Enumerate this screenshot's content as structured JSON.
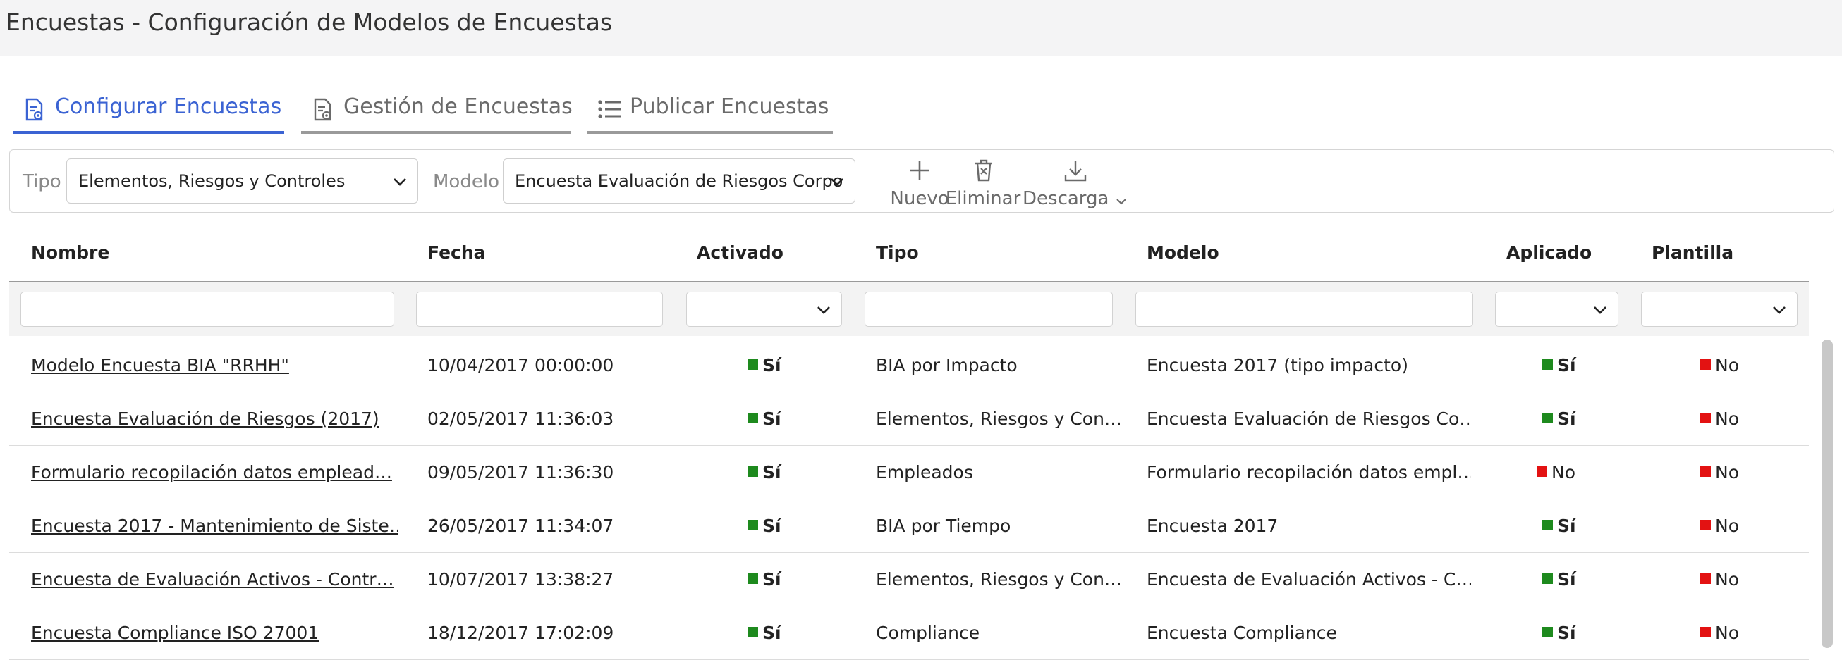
{
  "page": {
    "title": "Encuestas  - Configuración de Modelos de Encuestas"
  },
  "tabs": [
    {
      "label": "Configurar Encuestas",
      "icon": "document-gear-icon",
      "active": true
    },
    {
      "label": "Gestión de Encuestas",
      "icon": "document-gear-icon",
      "active": false
    },
    {
      "label": "Publicar Encuestas",
      "icon": "list-icon",
      "active": false
    }
  ],
  "filters": {
    "tipo_label": "Tipo",
    "tipo_value": "Elementos, Riesgos y Controles",
    "modelo_label": "Modelo",
    "modelo_value": "Encuesta Evaluación de Riesgos Corporativos"
  },
  "toolbar": {
    "nuevo": "Nuevo",
    "eliminar": "Eliminar",
    "descarga": "Descarga"
  },
  "table": {
    "columns": [
      "Nombre",
      "Fecha",
      "Activado",
      "Tipo",
      "Modelo",
      "Aplicado",
      "Plantilla"
    ],
    "rows": [
      {
        "nombre": "Modelo Encuesta BIA \"RRHH\"",
        "fecha": "10/04/2017 00:00:00",
        "activado": "Sí",
        "tipo": "BIA por Impacto",
        "modelo": "Encuesta 2017 (tipo impacto)",
        "aplicado": "Sí",
        "plantilla": "No"
      },
      {
        "nombre": "Encuesta Evaluación de Riesgos (2017)",
        "fecha": "02/05/2017 11:36:03",
        "activado": "Sí",
        "tipo": "Elementos, Riesgos y Con…",
        "modelo": "Encuesta Evaluación de Riesgos Co…",
        "aplicado": "Sí",
        "plantilla": "No"
      },
      {
        "nombre": "Formulario recopilación datos emplead…",
        "fecha": "09/05/2017 11:36:30",
        "activado": "Sí",
        "tipo": "Empleados",
        "modelo": "Formulario recopilación datos empl…",
        "aplicado": "No",
        "plantilla": "No"
      },
      {
        "nombre": "Encuesta 2017 - Mantenimiento de Siste…",
        "fecha": "26/05/2017 11:34:07",
        "activado": "Sí",
        "tipo": "BIA por Tiempo",
        "modelo": "Encuesta 2017",
        "aplicado": "Sí",
        "plantilla": "No"
      },
      {
        "nombre": "Encuesta de Evaluación Activos - Contr…",
        "fecha": "10/07/2017 13:38:27",
        "activado": "Sí",
        "tipo": "Elementos, Riesgos y Con…",
        "modelo": "Encuesta de Evaluación Activos - C…",
        "aplicado": "Sí",
        "plantilla": "No"
      },
      {
        "nombre": "Encuesta Compliance ISO 27001",
        "fecha": "18/12/2017 17:02:09",
        "activado": "Sí",
        "tipo": "Compliance",
        "modelo": "Encuesta Compliance",
        "aplicado": "Sí",
        "plantilla": "No"
      }
    ]
  },
  "colors": {
    "accent": "#3b63d3",
    "yes": "#1e8a1e",
    "no": "#e31212"
  }
}
